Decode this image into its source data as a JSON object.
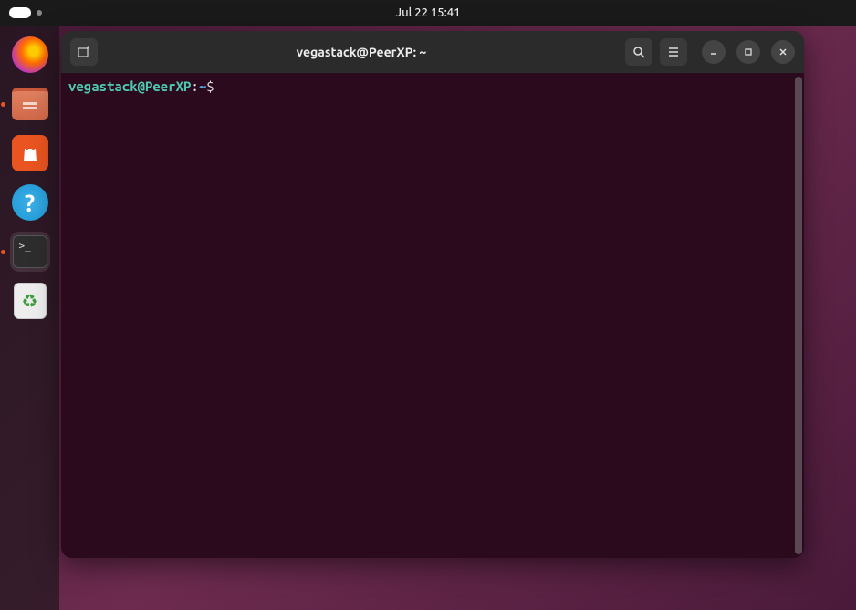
{
  "topbar": {
    "datetime": "Jul 22  15:41"
  },
  "dock": {
    "items": [
      {
        "name": "firefox",
        "label": "Firefox"
      },
      {
        "name": "files",
        "label": "Files"
      },
      {
        "name": "software",
        "label": "Ubuntu Software",
        "glyph": "A"
      },
      {
        "name": "help",
        "label": "Help",
        "glyph": "?"
      },
      {
        "name": "terminal",
        "label": "Terminal"
      },
      {
        "name": "trash",
        "label": "Trash"
      }
    ]
  },
  "terminal": {
    "title": "vegastack@PeerXP: ~",
    "prompt": {
      "user_host": "vegastack@PeerXP",
      "separator": ":",
      "path": "~",
      "symbol": "$"
    },
    "command": ""
  }
}
